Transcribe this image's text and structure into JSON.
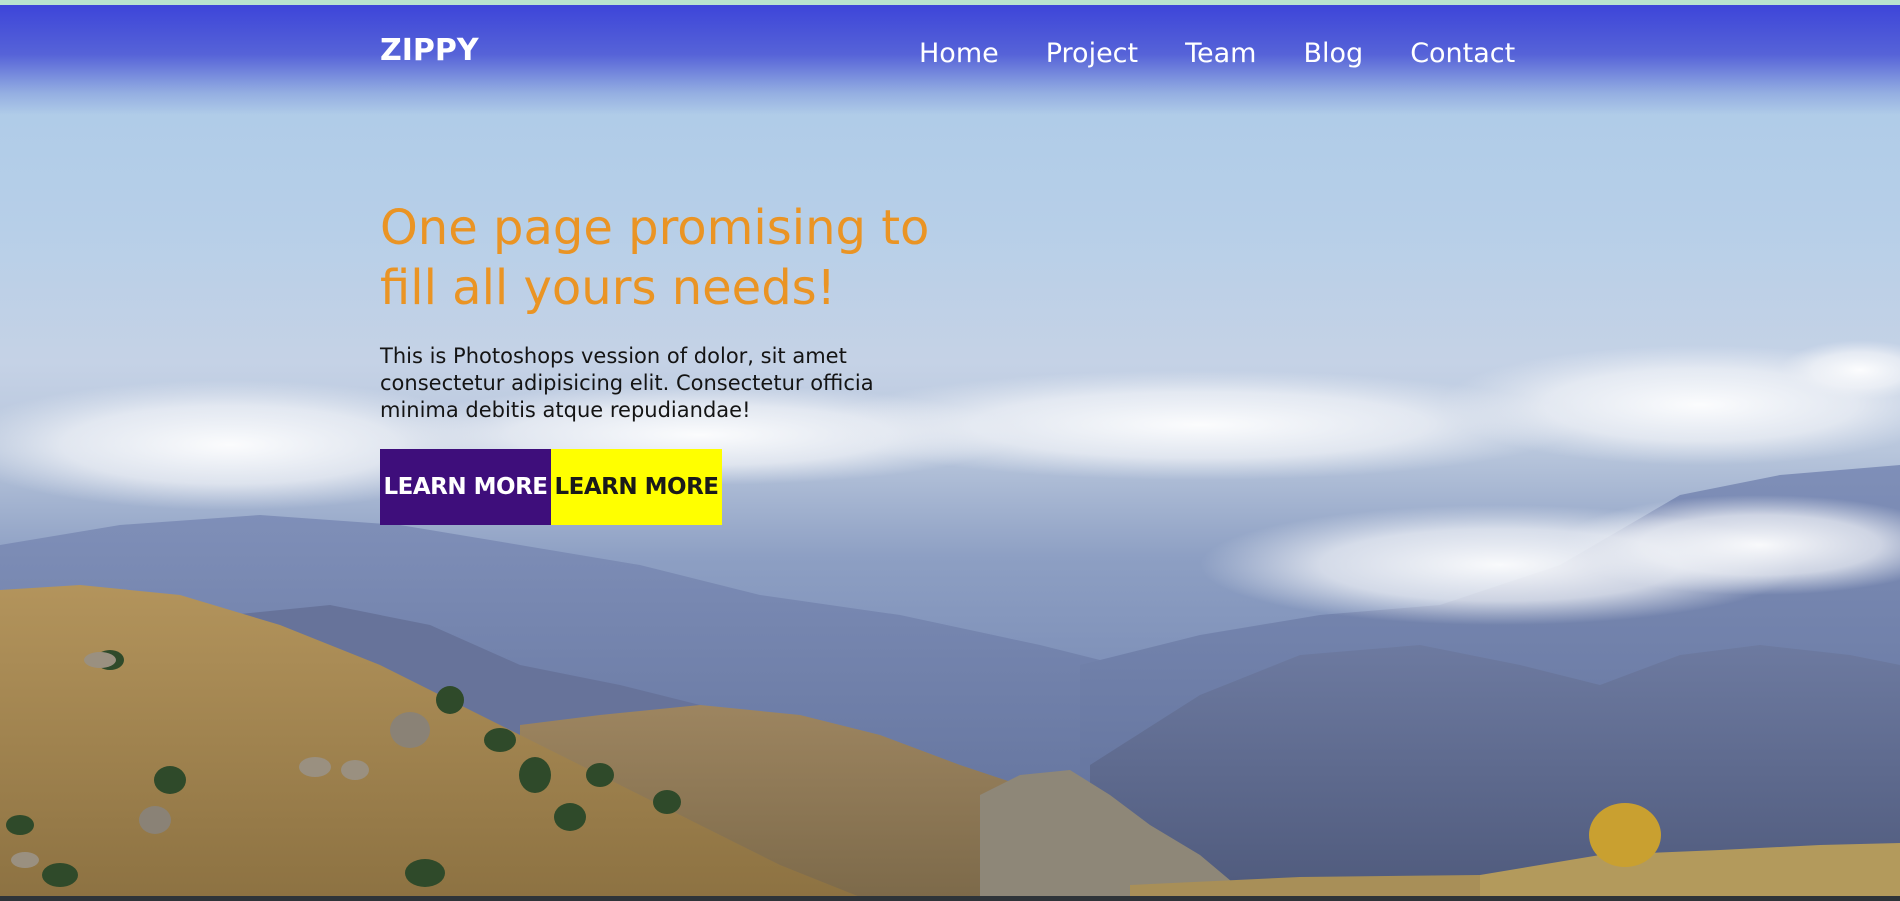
{
  "brand": {
    "name": "ZIPPY"
  },
  "nav": {
    "items": [
      {
        "label": "Home"
      },
      {
        "label": "Project"
      },
      {
        "label": "Team"
      },
      {
        "label": "Blog"
      },
      {
        "label": "Contact"
      }
    ]
  },
  "hero": {
    "headline_line1": "One page promising to",
    "headline_line2": "fill all yours needs!",
    "description_line1": "This is Photoshops vession of dolor, sit amet",
    "description_line2": "consectetur adipisicing elit. Consectetur officia",
    "description_line3": "minima debitis atque repudiandae!",
    "buttons": {
      "primary_label": "LEARN MORE",
      "secondary_label": "LEARN MORE"
    }
  },
  "colors": {
    "nav_bg": "#3d45d9",
    "headline": "#ea9424",
    "primary_button": "#3e0e7b",
    "secondary_button": "#ffff00"
  }
}
